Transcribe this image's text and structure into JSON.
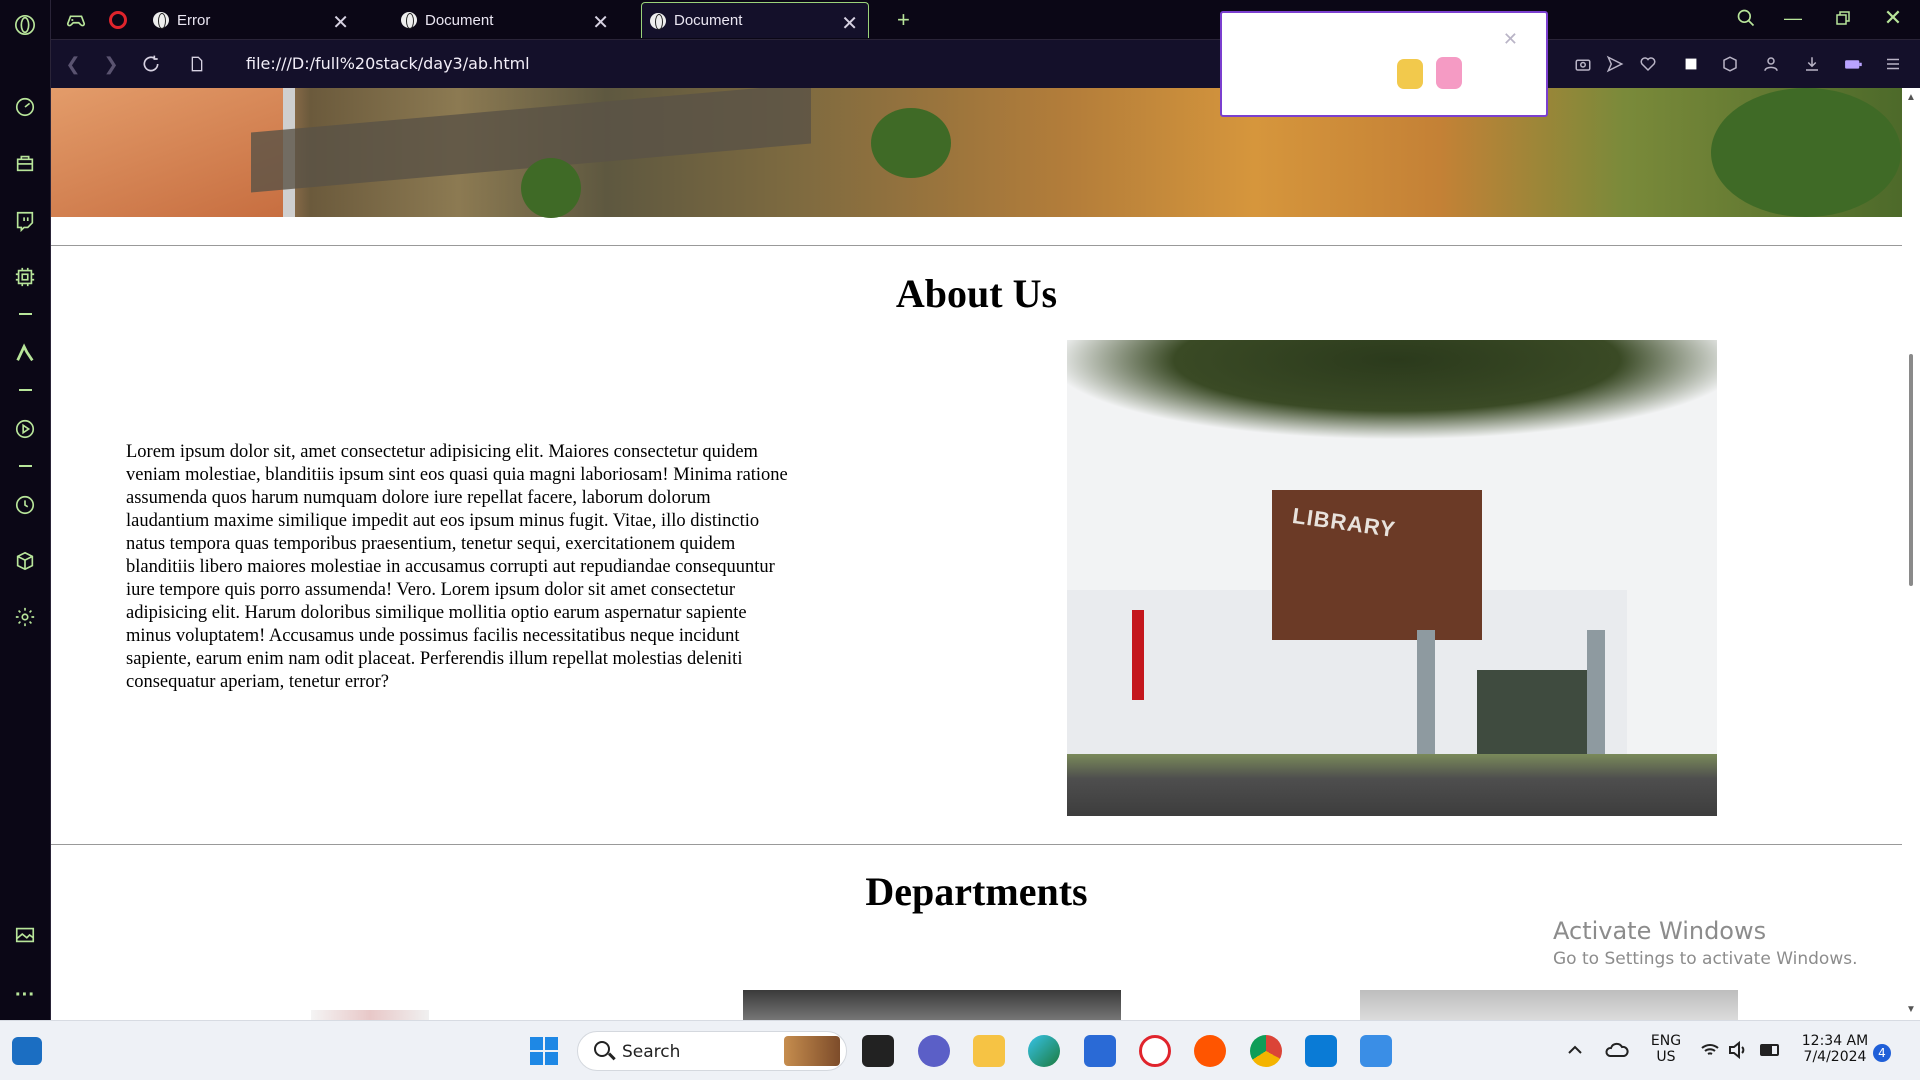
{
  "browser": {
    "tabs": [
      {
        "title": "Error",
        "active": false
      },
      {
        "title": "Document",
        "active": false
      },
      {
        "title": "Document",
        "active": true
      }
    ],
    "new_tab_label": "+",
    "url": "file:///D:/full%20stack/day3/ab.html"
  },
  "page": {
    "about_title": "About Us",
    "about_paragraph": "Lorem ipsum dolor sit, amet consectetur adipisicing elit. Maiores consectetur quidem veniam molestiae, blanditiis ipsum sint eos quasi quia magni laboriosam! Minima ratione assumenda quos harum numquam dolore iure repellat facere, laborum dolorum laudantium maxime similique impedit aut eos ipsum minus fugit. Vitae, illo distinctio natus tempora quas temporibus praesentium, tenetur sequi, exercitationem quidem blanditiis libero maiores molestiae in accusamus corrupti aut repudiandae consequuntur iure tempore quis porro assumenda! Vero. Lorem ipsum dolor sit amet consectetur adipisicing elit. Harum doloribus similique mollitia optio earum aspernatur sapiente minus voluptatem! Accusamus unde possimus facilis necessitatibus neque incidunt sapiente, earum enim nam odit placeat. Perferendis illum repellat molestias deleniti consequatur aperiam, tenetur error?",
    "library_sign": "LIBRARY",
    "departments_title": "Departments"
  },
  "watermark": {
    "line1": "Activate Windows",
    "line2": "Go to Settings to activate Windows."
  },
  "taskbar": {
    "search_label": "Search",
    "language": "ENG",
    "region": "US",
    "time": "12:34 AM",
    "date": "7/4/2024",
    "notification_count": "4"
  },
  "colors": {
    "gx_accent": "#b8e59a",
    "browser_bg": "#0b0716",
    "popup_border": "#7b3fcf"
  }
}
